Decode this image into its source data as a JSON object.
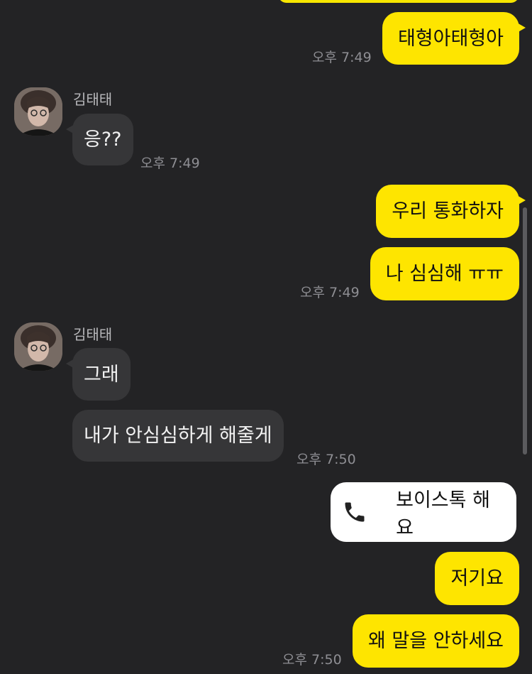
{
  "colors": {
    "background": "#232325",
    "my_bubble": "#FEE500",
    "other_bubble": "#363638",
    "voice_card": "#FFFFFF",
    "timestamp": "#8E8E93"
  },
  "messages": {
    "m1": {
      "text": "태형아태형아",
      "time": "오후 7:49"
    },
    "other1": {
      "sender": "김태태",
      "text": "응??",
      "time": "오후 7:49"
    },
    "m2": {
      "text": "우리 통화하자"
    },
    "m3": {
      "text": "나 심심해 ㅠㅠ",
      "time": "오후 7:49"
    },
    "other2": {
      "sender": "김태태",
      "text1": "그래",
      "text2": "내가 안심심하게 해줄게",
      "time": "오후 7:50"
    },
    "voice_call": {
      "icon": "phone-icon",
      "text": "보이스톡 해요"
    },
    "m4": {
      "text": "저기요"
    },
    "m5": {
      "text": "왜 말을 안하세요",
      "time": "오후 7:50"
    }
  }
}
